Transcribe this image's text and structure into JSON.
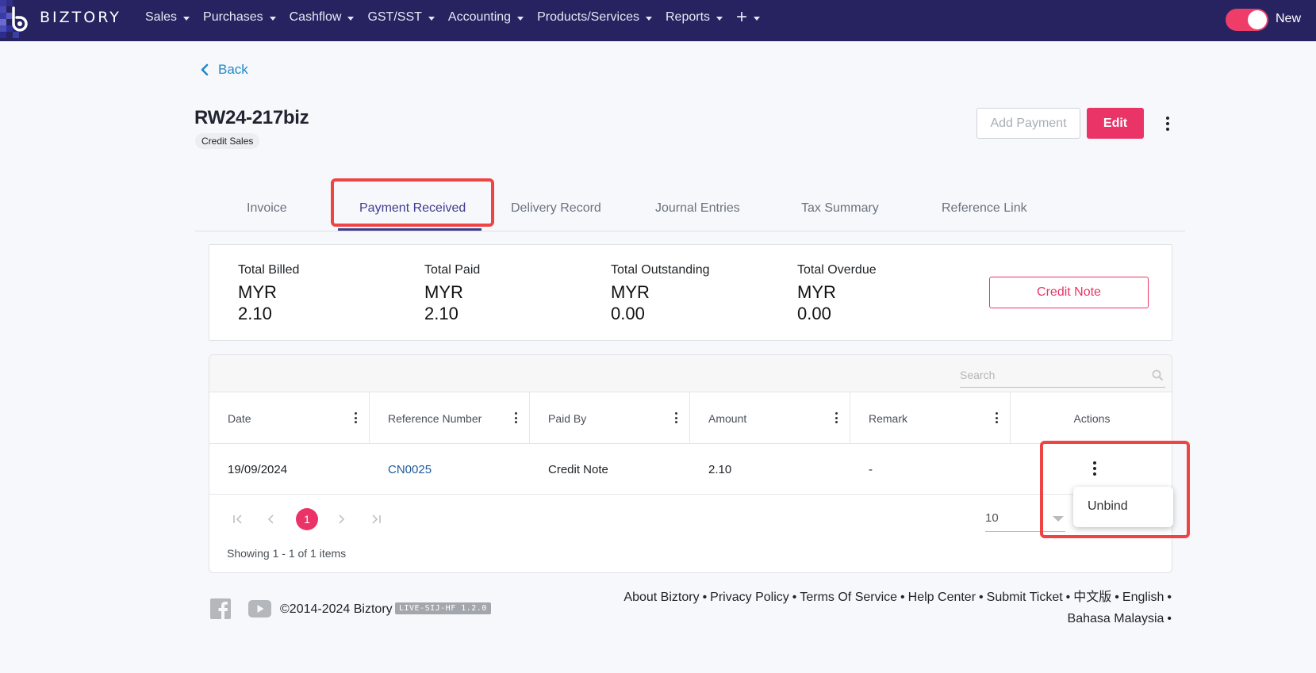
{
  "brand": {
    "name": "BIZTORY"
  },
  "nav": {
    "items": [
      {
        "label": "Sales"
      },
      {
        "label": "Purchases"
      },
      {
        "label": "Cashflow"
      },
      {
        "label": "GST/SST"
      },
      {
        "label": "Accounting"
      },
      {
        "label": "Products/Services"
      },
      {
        "label": "Reports"
      }
    ],
    "plus": "+",
    "toggle_label": "New"
  },
  "back_label": "Back",
  "document": {
    "title": "RW24-217biz",
    "badge": "Credit Sales",
    "add_payment_label": "Add Payment",
    "edit_label": "Edit"
  },
  "tabs": [
    {
      "label": "Invoice"
    },
    {
      "label": "Payment Received"
    },
    {
      "label": "Delivery Record"
    },
    {
      "label": "Journal Entries"
    },
    {
      "label": "Tax Summary"
    },
    {
      "label": "Reference Link"
    }
  ],
  "active_tab": "Payment Received",
  "summary": [
    {
      "label": "Total Billed",
      "currency": "MYR",
      "value": "2.10"
    },
    {
      "label": "Total Paid",
      "currency": "MYR",
      "value": "2.10"
    },
    {
      "label": "Total Outstanding",
      "currency": "MYR",
      "value": "0.00"
    },
    {
      "label": "Total Overdue",
      "currency": "MYR",
      "value": "0.00"
    }
  ],
  "credit_note_label": "Credit Note",
  "grid": {
    "search_placeholder": "Search",
    "columns": [
      "Date",
      "Reference Number",
      "Paid By",
      "Amount",
      "Remark",
      "Actions"
    ],
    "rows": [
      {
        "date": "19/09/2024",
        "reference": "CN0025",
        "paid_by": "Credit Note",
        "amount": "2.10",
        "remark": "-"
      }
    ],
    "pager": {
      "current_page": "1",
      "page_size": "10",
      "info": "Showing 1 - 1 of 1 items"
    }
  },
  "row_menu": {
    "items": [
      {
        "label": "Unbind"
      }
    ]
  },
  "footer": {
    "copyright": "©2014-2024 Biztory",
    "version": "LIVE-SIJ-HF 1.2.0",
    "links": [
      {
        "label": "About Biztory"
      },
      {
        "label": "Privacy Policy"
      },
      {
        "label": "Terms Of Service"
      },
      {
        "label": "Help Center"
      },
      {
        "label": "Submit Ticket"
      },
      {
        "label": "中文版"
      },
      {
        "label": "English"
      },
      {
        "label": "Bahasa Malaysia"
      }
    ],
    "separator": "•"
  },
  "colors": {
    "topbar": "#262360",
    "accent": "#ea3468",
    "active_tab": "#3f3c8f",
    "link": "#1e88c9",
    "highlight": "#ef4444"
  }
}
